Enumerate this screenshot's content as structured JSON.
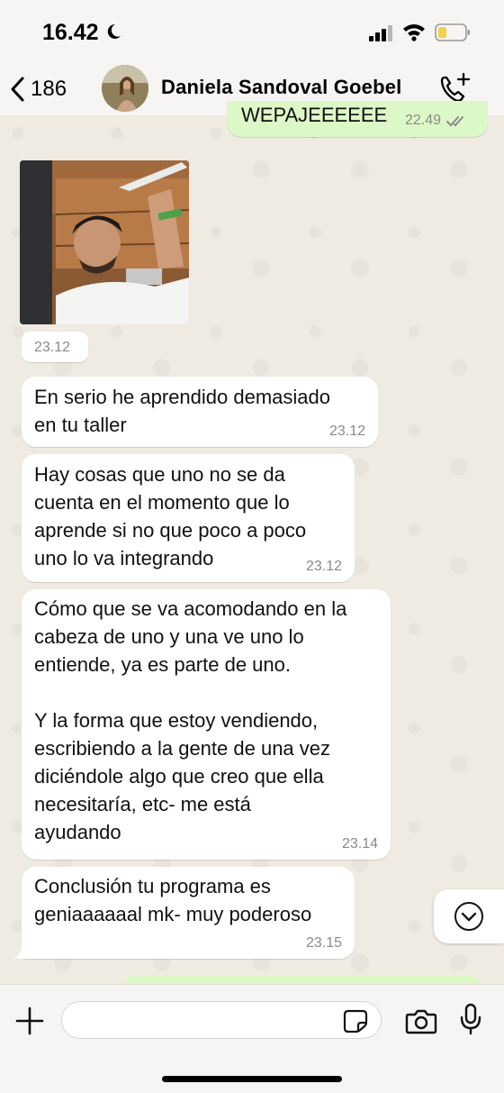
{
  "status_bar": {
    "time": "16.42"
  },
  "header": {
    "back_count": "186",
    "contact_name": "Daniela Sandoval Goebel"
  },
  "messages": [
    {
      "text": "WEPAJEEEEEE",
      "time": "22.49"
    },
    {
      "time": "23.12"
    },
    {
      "text": "En serio he aprendido demasiado\nen tu taller",
      "time": "23.12"
    },
    {
      "text": "Hay cosas que uno no se da\ncuenta en el momento que lo\naprende si no que poco a poco\nuno lo va integrando",
      "time": "23.12"
    },
    {
      "text": "Cómo que se va acomodando en la\ncabeza de uno y una ve uno lo\nentiende, ya es parte de uno.\n\nY la forma que estoy vendiendo,\nescribiendo a la gente de una vez\ndiciéndole algo que creo que ella\nnecesitaría, etc- me está\nayudando",
      "time": "23.14"
    },
    {
      "text": "Conclusión tu programa es\ngeniaaaaaal mk- muy poderoso",
      "time": "23.15"
    }
  ],
  "icons": {
    "back": "chevron-left-icon",
    "call_add": "phone-plus-icon",
    "scroll": "chevron-down-icon",
    "attach": "plus-icon",
    "sticker": "sticker-icon",
    "camera": "camera-icon",
    "mic": "microphone-icon"
  },
  "colors": {
    "outgoing": "#dcf8c6",
    "incoming": "#ffffff",
    "background": "#efeae2",
    "read_ticks": "#8a8a8a"
  }
}
